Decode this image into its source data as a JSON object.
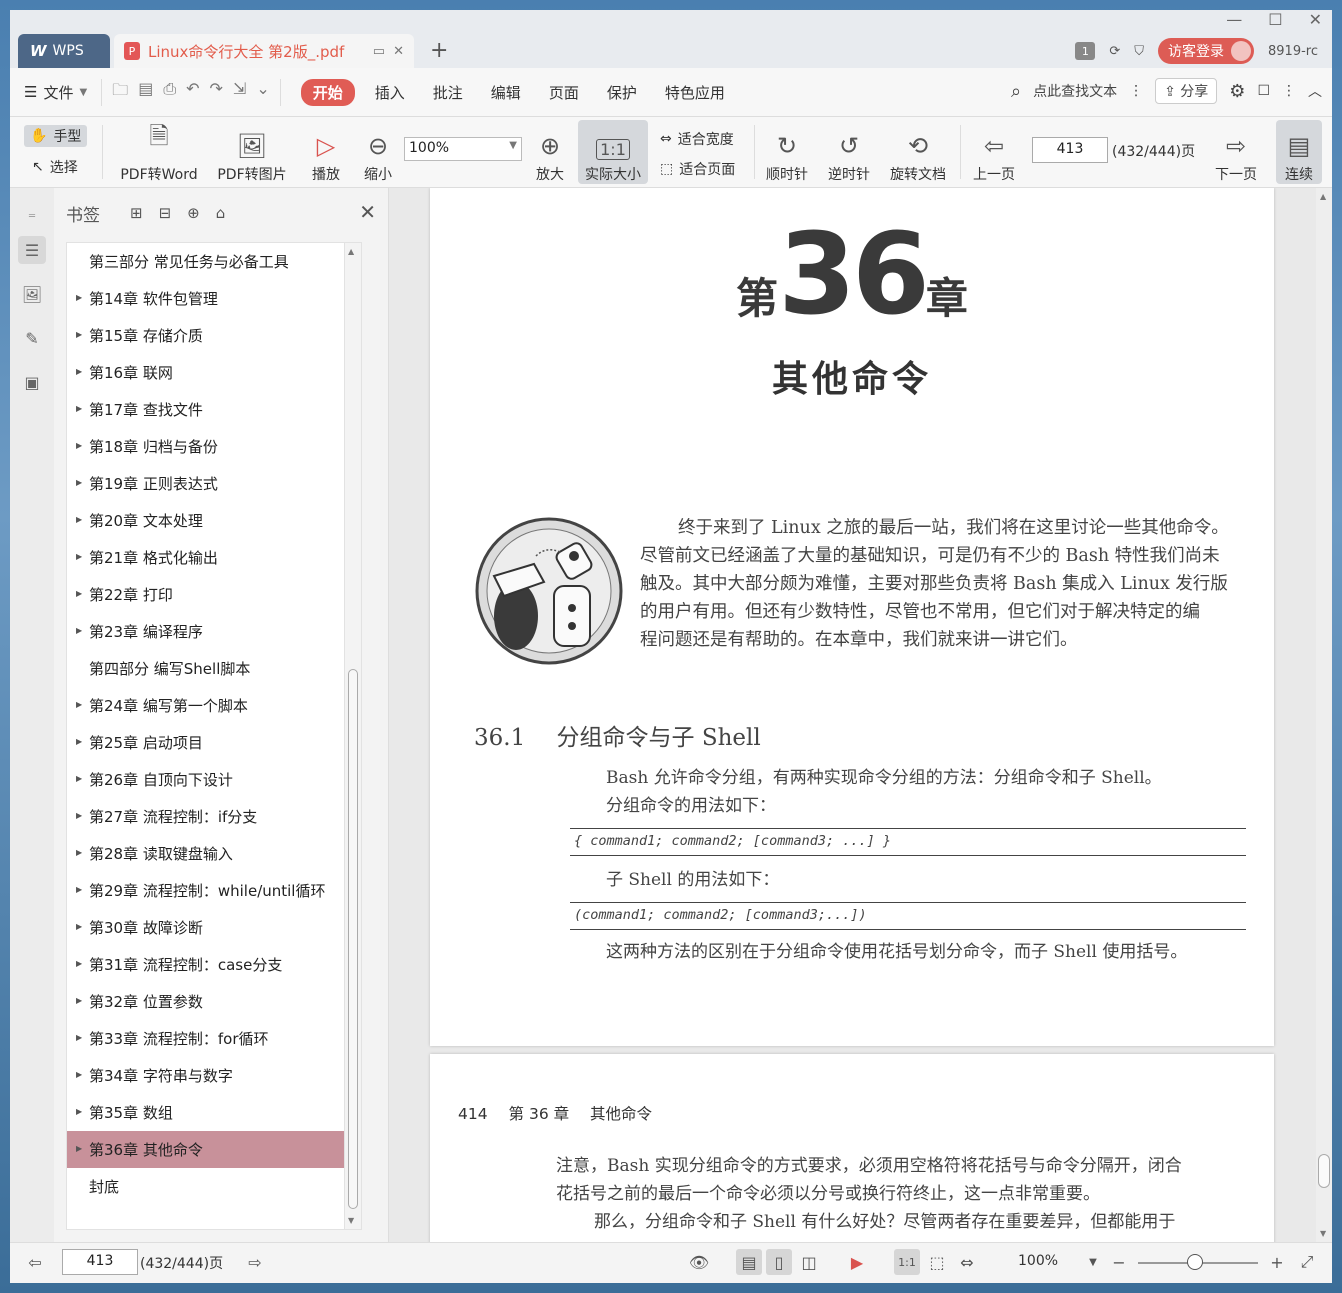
{
  "titlebar": {
    "app_tab": "WPS",
    "doc_tab_title": "Linux命令行大全 第2版_.pdf",
    "new_tab": "+",
    "page_counter": "1",
    "login_label": "访客登录",
    "user_id": "8919-rc"
  },
  "menu": {
    "file": "文件",
    "items": [
      "开始",
      "插入",
      "批注",
      "编辑",
      "页面",
      "保护",
      "特色应用"
    ],
    "search": "点此查找文本",
    "share": "分享"
  },
  "toolbar": {
    "hand": "手型",
    "select": "选择",
    "pdf_to_word": "PDF转Word",
    "pdf_to_image": "PDF转图片",
    "play": "播放",
    "zoom_out": "缩小",
    "zoom_value": "100%",
    "zoom_in": "放大",
    "actual_size": "实际大小",
    "fit_width": "适合宽度",
    "fit_page": "适合页面",
    "clockwise": "顺时针",
    "counterclockwise": "逆时针",
    "rotate_doc": "旋转文档",
    "prev_page": "上一页",
    "page_input": "413",
    "page_total": "(432/444)页",
    "next_page": "下一页",
    "continuous": "连续"
  },
  "bookmarks": {
    "title": "书签",
    "items": [
      {
        "label": "第三部分 常见任务与必备工具",
        "expandable": false
      },
      {
        "label": "第14章 软件包管理",
        "expandable": true
      },
      {
        "label": "第15章 存储介质",
        "expandable": true
      },
      {
        "label": "第16章 联网",
        "expandable": true
      },
      {
        "label": "第17章 查找文件",
        "expandable": true
      },
      {
        "label": "第18章 归档与备份",
        "expandable": true
      },
      {
        "label": "第19章 正则表达式",
        "expandable": true
      },
      {
        "label": "第20章 文本处理",
        "expandable": true
      },
      {
        "label": "第21章 格式化输出",
        "expandable": true
      },
      {
        "label": "第22章 打印",
        "expandable": true
      },
      {
        "label": "第23章 编译程序",
        "expandable": true
      },
      {
        "label": "第四部分 编写Shell脚本",
        "expandable": false
      },
      {
        "label": "第24章 编写第一个脚本",
        "expandable": true
      },
      {
        "label": "第25章 启动项目",
        "expandable": true
      },
      {
        "label": "第26章 自顶向下设计",
        "expandable": true
      },
      {
        "label": "第27章 流程控制：if分支",
        "expandable": true
      },
      {
        "label": "第28章 读取键盘输入",
        "expandable": true
      },
      {
        "label": "第29章 流程控制：while/until循环",
        "expandable": true
      },
      {
        "label": "第30章 故障诊断",
        "expandable": true
      },
      {
        "label": "第31章 流程控制：case分支",
        "expandable": true
      },
      {
        "label": "第32章 位置参数",
        "expandable": true
      },
      {
        "label": "第33章 流程控制：for循环",
        "expandable": true
      },
      {
        "label": "第34章 字符串与数字",
        "expandable": true
      },
      {
        "label": "第35章 数组",
        "expandable": true
      },
      {
        "label": "第36章 其他命令",
        "expandable": true,
        "selected": true
      },
      {
        "label": "封底",
        "expandable": false
      }
    ]
  },
  "page1": {
    "chapter_prefix": "第",
    "chapter_number": "36",
    "chapter_suffix": "章",
    "chapter_title": "其他命令",
    "intro_lines": [
      "终于来到了 Linux 之旅的最后一站，我们将在这里讨论一些其他命令。",
      "尽管前文已经涵盖了大量的基础知识，可是仍有不少的 Bash 特性我们尚未",
      "触及。其中大部分颇为难懂，主要对那些负责将 Bash 集成入 Linux 发行版",
      "的用户有用。但还有少数特性，尽管也不常用，但它们对于解决特定的编",
      "程问题还是有帮助的。在本章中，我们就来讲一讲它们。"
    ],
    "section_number": "36.1",
    "section_title": "分组命令与子 Shell",
    "para1_line1": "Bash 允许命令分组，有两种实现命令分组的方法：分组命令和子 Shell。",
    "para1_line2": "分组命令的用法如下：",
    "code1": "{ command1; command2; [command3; ...] }",
    "para2": "子 Shell 的用法如下：",
    "code2": "(command1; command2; [command3;...])",
    "para3": "这两种方法的区别在于分组命令使用花括号划分命令，而子 Shell 使用括号。"
  },
  "page2": {
    "page_no": "414",
    "chapter": "第 36 章",
    "chapter_title": "其他命令",
    "lines": [
      "注意，Bash 实现分组命令的方式要求，必须用空格符将花括号与命令分隔开，闭合",
      "花括号之前的最后一个命令必须以分号或换行符终止，这一点非常重要。",
      "那么，分组命令和子 Shell 有什么好处？尽管两者存在重要差异，但都能用于"
    ]
  },
  "statusbar": {
    "page_input": "413",
    "page_total": "(432/444)页",
    "zoom": "100%",
    "zoom_slider_percent": 100
  },
  "colors": {
    "accent": "#e05c55",
    "selected_bookmark": "#c8919a",
    "wps_tab": "#4d6787"
  }
}
